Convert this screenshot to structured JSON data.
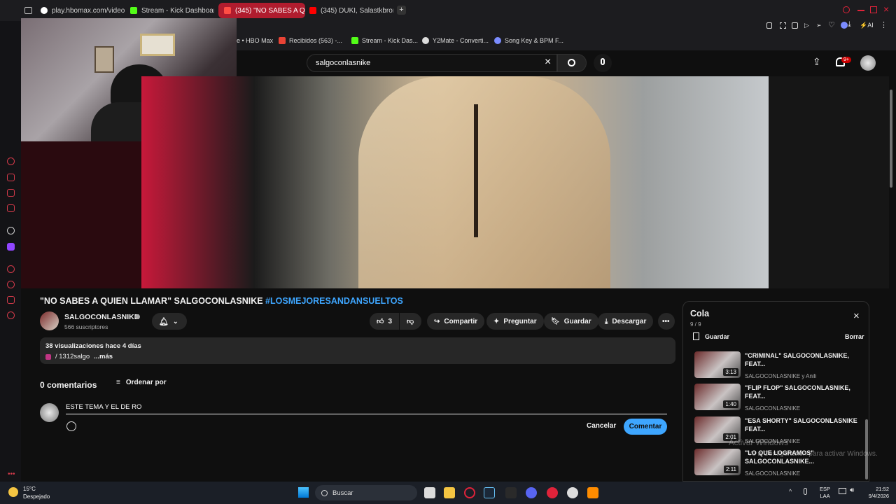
{
  "tabs": [
    {
      "label": "play.hbomax.com/video/w",
      "color": "#9b6cff"
    },
    {
      "label": "Stream - Kick Dashboard",
      "color": "#53fc18"
    },
    {
      "label": "(345) \"NO SABES A QUIE",
      "color": "#ff0000",
      "active": true
    },
    {
      "label": "(345) DUKI, Salastkbron",
      "color": "#ff0000"
    }
  ],
  "new_tab_icon": "plus-icon",
  "bookmarks": [
    {
      "label": "e • HBO Max"
    },
    {
      "label": "Recibidos (563) -...",
      "color": "#ea4335"
    },
    {
      "label": "Stream - Kick Das...",
      "color": "#53fc18"
    },
    {
      "label": "Y2Mate - Converti...",
      "color": "#dddddd"
    },
    {
      "label": "Song Key & BPM F...",
      "color": "#7b8cff"
    }
  ],
  "search": {
    "value": "salgoconlasnike"
  },
  "notifications_badge": "9+",
  "video": {
    "title_main": "\"NO SABES A QUIEN LLAMAR\" SALGOCONLASNIKE ",
    "title_tag": "#LOSMEJORESANDANSUELTOS",
    "channel": "SALGOCONLASNIKE",
    "subscribers": "566 suscriptores",
    "likes": "3",
    "share": "Compartir",
    "ask": "Preguntar",
    "save": "Guardar",
    "download": "Descargar",
    "stats": "38 visualizaciones  hace 4 días",
    "desc_handle": "/ 1312salgo",
    "desc_more": "...más"
  },
  "comments": {
    "count": "0 comentarios",
    "sort": "Ordenar por",
    "draft": "ESTE TEMA Y EL DE RO",
    "cancel": "Cancelar",
    "submit": "Comentar"
  },
  "queue": {
    "title": "Cola",
    "position": "9 / 9",
    "save": "Guardar",
    "clear": "Borrar",
    "items": [
      {
        "title": "\"CRIMINAL\" SALGOCONLASNIKE, FEAT...",
        "channel": "SALGOCONLASNIKE y Anili",
        "duration": "3:13"
      },
      {
        "title": "\"FLIP FLOP\" SALGOCONLASNIKE, FEAT...",
        "channel": "SALGOCONLASNIKE",
        "duration": "1:40"
      },
      {
        "title": "\"ESA SHORTY\" SALGOCONLASNIKE FEAT...",
        "channel": "SALGOCONLASNIKE",
        "duration": "2:01"
      },
      {
        "title": "\"LO QUE LOGRAMOS\" SALGOCONLASNIKE...",
        "channel": "SALGOCONLASNIKE",
        "duration": "2:11"
      }
    ]
  },
  "watermark": {
    "line1": "Activar Windows",
    "line2": "Ve a Configuración para activar Windows."
  },
  "taskbar": {
    "weather_temp": "15°C",
    "weather_desc": "Despejado",
    "search": "Buscar",
    "lang": "ESP",
    "lang2": "LAA",
    "time": "21:52",
    "date": "9/4/2026"
  }
}
